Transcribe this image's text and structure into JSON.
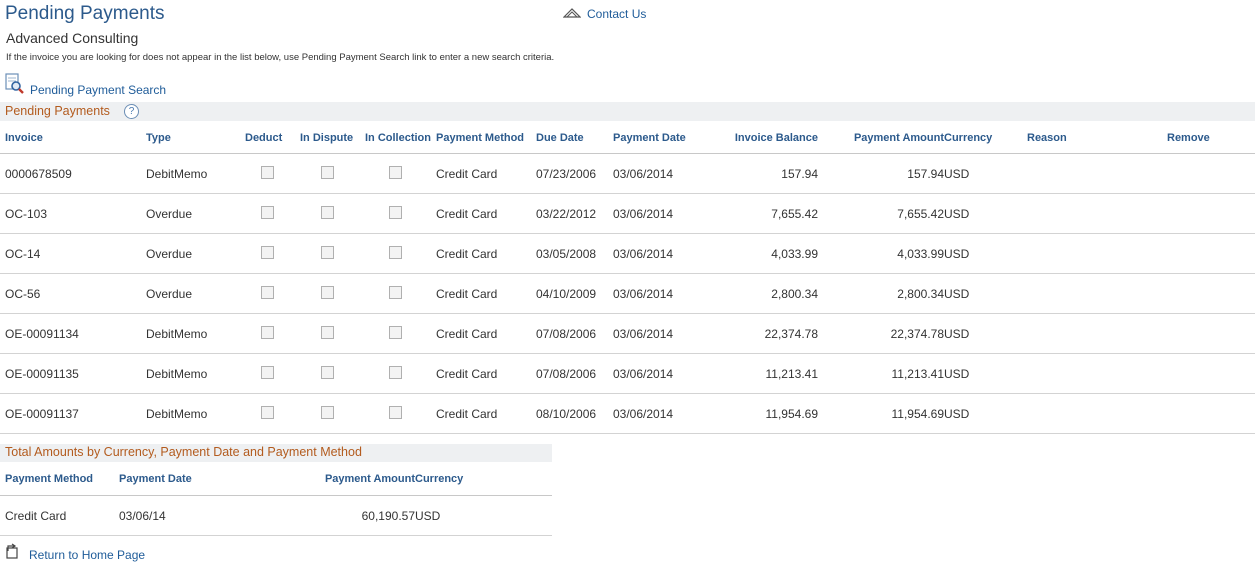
{
  "page": {
    "title": "Pending Payments",
    "subtitle": "Advanced Consulting",
    "note": "If the invoice you are looking for does not appear in the list below, use Pending Payment Search link to enter a new search criteria.",
    "contact_label": "Contact Us",
    "search_link": "Pending Payment Search",
    "home_link": "Return to Home Page"
  },
  "grid": {
    "title": "Pending Payments",
    "help": "?",
    "columns": [
      "Invoice",
      "Type",
      "Deduct",
      "In Dispute",
      "In Collection",
      "Payment Method",
      "Due Date",
      "Payment Date",
      "Invoice Balance",
      "Payment Amount",
      "Currency",
      "Reason",
      "Remove"
    ],
    "rows": [
      {
        "invoice": "0000678509",
        "type": "DebitMemo",
        "deduct": false,
        "dispute": false,
        "collection": false,
        "method": "Credit Card",
        "due": "07/23/2006",
        "paydate": "03/06/2014",
        "balance": "157.94",
        "amount": "157.94",
        "currency": "USD"
      },
      {
        "invoice": "OC-103",
        "type": "Overdue",
        "deduct": false,
        "dispute": false,
        "collection": false,
        "method": "Credit Card",
        "due": "03/22/2012",
        "paydate": "03/06/2014",
        "balance": "7,655.42",
        "amount": "7,655.42",
        "currency": "USD"
      },
      {
        "invoice": "OC-14",
        "type": "Overdue",
        "deduct": false,
        "dispute": false,
        "collection": false,
        "method": "Credit Card",
        "due": "03/05/2008",
        "paydate": "03/06/2014",
        "balance": "4,033.99",
        "amount": "4,033.99",
        "currency": "USD"
      },
      {
        "invoice": "OC-56",
        "type": "Overdue",
        "deduct": false,
        "dispute": false,
        "collection": false,
        "method": "Credit Card",
        "due": "04/10/2009",
        "paydate": "03/06/2014",
        "balance": "2,800.34",
        "amount": "2,800.34",
        "currency": "USD"
      },
      {
        "invoice": "OE-00091134",
        "type": "DebitMemo",
        "deduct": false,
        "dispute": false,
        "collection": false,
        "method": "Credit Card",
        "due": "07/08/2006",
        "paydate": "03/06/2014",
        "balance": "22,374.78",
        "amount": "22,374.78",
        "currency": "USD"
      },
      {
        "invoice": "OE-00091135",
        "type": "DebitMemo",
        "deduct": false,
        "dispute": false,
        "collection": false,
        "method": "Credit Card",
        "due": "07/08/2006",
        "paydate": "03/06/2014",
        "balance": "11,213.41",
        "amount": "11,213.41",
        "currency": "USD"
      },
      {
        "invoice": "OE-00091137",
        "type": "DebitMemo",
        "deduct": false,
        "dispute": false,
        "collection": false,
        "method": "Credit Card",
        "due": "08/10/2006",
        "paydate": "03/06/2014",
        "balance": "11,954.69",
        "amount": "11,954.69",
        "currency": "USD"
      }
    ]
  },
  "totals": {
    "title": "Total Amounts by Currency, Payment Date and Payment Method",
    "columns": [
      "Payment Method",
      "Payment Date",
      "Payment Amount",
      "Currency"
    ],
    "rows": [
      {
        "method": "Credit Card",
        "paydate": "03/06/14",
        "amount": "60,190.57",
        "currency": "USD"
      }
    ]
  },
  "icons": {
    "contact": "contact-icon",
    "search": "magnifier-document-icon",
    "help": "help-icon",
    "home": "return-home-icon"
  },
  "colors": {
    "title_blue": "#2c5a8c",
    "link_blue": "#1f5c99",
    "section_orange": "#b35b1e",
    "header_bg": "#eef0f2"
  }
}
